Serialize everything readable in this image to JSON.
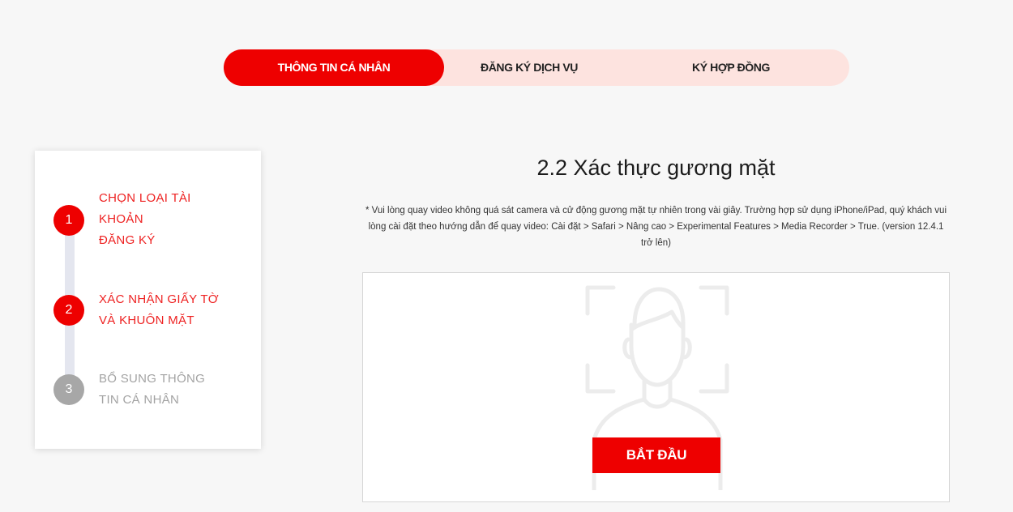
{
  "tabs": [
    {
      "label": "THÔNG TIN CÁ NHÂN",
      "active": true
    },
    {
      "label": "ĐĂNG KÝ DỊCH VỤ",
      "active": false
    },
    {
      "label": "KÝ HỢP ĐỒNG",
      "active": false
    }
  ],
  "steps": [
    {
      "number": "1",
      "label": "CHỌN LOẠI TÀI\nKHOẢN\nĐĂNG KÝ",
      "status": "done"
    },
    {
      "number": "2",
      "label": "XÁC NHẬN GIẤY TỜ\nVÀ KHUÔN MẶT",
      "status": "done"
    },
    {
      "number": "3",
      "label": "BỔ SUNG THÔNG\nTIN CÁ NHÂN",
      "status": "pending"
    }
  ],
  "main": {
    "title": "2.2 Xác thực gương mặt",
    "note": "* Vui lòng quay video không quá sát camera và cử động gương mặt tự nhiên trong vài giây. Trường hợp sử dụng iPhone/iPad, quý khách vui lòng cài đặt theo hướng dẫn để quay video: Cài đặt > Safari > Nâng cao > Experimental Features > Media Recorder > True. (version 12.4.1 trở lên)",
    "start_label": "BẮT ĐẦU",
    "placeholder_icon": "face-scan-icon"
  },
  "colors": {
    "accent": "#ee0000",
    "tab_bg": "#fde3df",
    "step_pending": "#a7a7a7",
    "rail": "#e4e6ef"
  }
}
